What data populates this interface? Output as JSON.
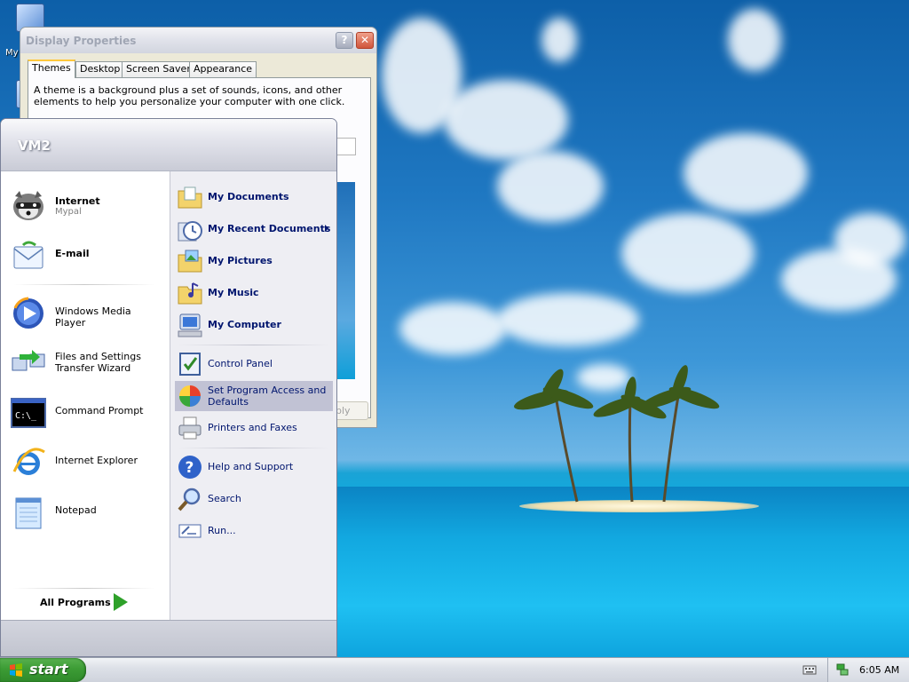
{
  "desktop": {
    "icon_label_partial": "My"
  },
  "dialog": {
    "title": "Display Properties",
    "tabs": [
      "Themes",
      "Desktop",
      "Screen Saver",
      "Appearance"
    ],
    "active_tab": "Themes",
    "description": "A theme is a background plus a set of sounds, icons, and other elements to help you personalize your computer with one click.",
    "apply_partial": "ply"
  },
  "start_menu": {
    "username": "VM2",
    "pinned": [
      {
        "label": "Internet",
        "sub": "Mypal",
        "icon": "raccoon-browser-icon"
      },
      {
        "label": "E-mail",
        "icon": "email-envelope-icon"
      }
    ],
    "recent": [
      {
        "label": "Windows Media Player",
        "icon": "media-player-icon"
      },
      {
        "label": "Files and Settings Transfer Wizard",
        "label_line1": "Files and Settings",
        "label_line2": "Transfer Wizard",
        "icon": "transfer-wizard-icon"
      },
      {
        "label": "Command Prompt",
        "icon": "command-prompt-icon"
      },
      {
        "label": "Internet Explorer",
        "icon": "internet-explorer-icon"
      },
      {
        "label": "Notepad",
        "icon": "notepad-icon"
      }
    ],
    "all_programs": "All Programs",
    "places": [
      {
        "label": "My Documents",
        "icon": "folder-documents-icon"
      },
      {
        "label": "My Recent Documents",
        "icon": "recent-documents-icon"
      },
      {
        "label": "My Pictures",
        "icon": "folder-pictures-icon"
      },
      {
        "label": "My Music",
        "icon": "folder-music-icon"
      },
      {
        "label": "My Computer",
        "icon": "computer-icon"
      }
    ],
    "system": [
      {
        "label": "Control Panel",
        "icon": "control-panel-icon"
      },
      {
        "label": "Set Program Access and Defaults",
        "label_line1": "Set Program Access and",
        "label_line2": "Defaults",
        "icon": "program-access-icon",
        "highlighted": true
      },
      {
        "label": "Printers and Faxes",
        "icon": "printer-icon"
      }
    ],
    "tools": [
      {
        "label": "Help and Support",
        "icon": "help-icon"
      },
      {
        "label": "Search",
        "icon": "search-icon"
      },
      {
        "label": "Run...",
        "icon": "run-icon"
      }
    ]
  },
  "taskbar": {
    "start_label": "start",
    "clock": "6:05 AM"
  },
  "colors": {
    "start_green": "#3c9c35",
    "link_blue": "#00156e",
    "menu_highlight": "#c1c2d4"
  }
}
